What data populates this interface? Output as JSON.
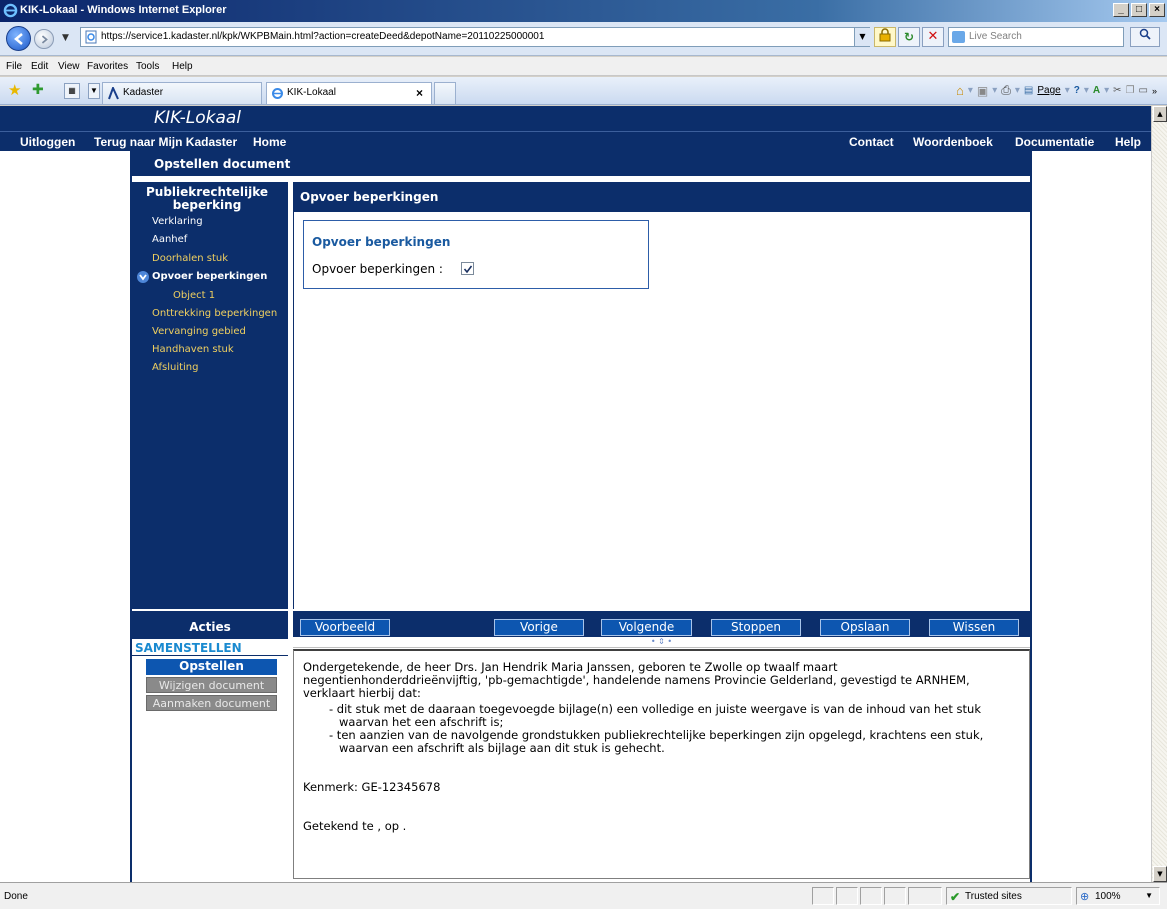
{
  "window": {
    "title": "KIK-Lokaal - Windows Internet Explorer",
    "buttons": [
      "_",
      "□",
      "×"
    ]
  },
  "address_bar": {
    "url": "https://service1.kadaster.nl/kpk/WKPBMain.html?action=createDeed&depotName=20110225000001",
    "search_placeholder": "Live Search"
  },
  "menu": {
    "items": [
      "File",
      "Edit",
      "View",
      "Favorites",
      "Tools",
      "Help"
    ]
  },
  "tabs": [
    {
      "label": "Kadaster"
    },
    {
      "label": "KIK-Lokaal",
      "active": true
    }
  ],
  "command_bar": {
    "page_label": "Page",
    "home_icon": "home-icon",
    "feeds_icon": "feeds-icon",
    "print_icon": "print-icon",
    "tools_icon": "tools-icon",
    "help_icon": "help-icon"
  },
  "app": {
    "title": "KIK-Lokaal",
    "nav_left": [
      "Uitloggen",
      "Terug naar Mijn Kadaster",
      "Home"
    ],
    "nav_right": [
      "Contact",
      "Woordenboek",
      "Documentatie",
      "Help"
    ],
    "document_header": "Opstellen document",
    "colors": {
      "primary": "#0c2e6b",
      "accent": "#0d56b0",
      "nav_link": "#f0d060"
    }
  },
  "sidebar": {
    "title_line1": "Publiekrechtelijke",
    "title_line2": "beperking",
    "items": [
      {
        "label": "Verklaring",
        "state": "visited"
      },
      {
        "label": "Aanhef",
        "state": "visited"
      },
      {
        "label": "Doorhalen stuk",
        "state": "normal"
      },
      {
        "label": "Opvoer beperkingen",
        "state": "active"
      },
      {
        "label": "Object 1",
        "state": "normal"
      },
      {
        "label": "Onttrekking beperkingen",
        "state": "normal"
      },
      {
        "label": "Vervanging gebied",
        "state": "normal"
      },
      {
        "label": "Handhaven stuk",
        "state": "normal"
      },
      {
        "label": "Afsluiting",
        "state": "normal"
      }
    ]
  },
  "content": {
    "heading": "Opvoer beperkingen",
    "fieldset_title": "Opvoer beperkingen",
    "field_label": "Opvoer beperkingen :",
    "field_checked": true
  },
  "actions": {
    "title": "Acties",
    "section": "SAMENSTELLEN",
    "buttons": [
      {
        "label": "Opstellen document",
        "enabled": true
      },
      {
        "label": "Wijzigen document",
        "enabled": false
      },
      {
        "label": "Aanmaken document",
        "enabled": false
      }
    ]
  },
  "button_bar": [
    "Voorbeeld",
    "Vorige",
    "Volgende",
    "Stoppen",
    "Opslaan",
    "Wissen"
  ],
  "preview": {
    "paragraph": "Ondergetekende, de heer Drs. Jan Hendrik Maria Janssen, geboren te Zwolle op twaalf maart negentienhonderddrieënvijftig, 'pb-gemachtigde', handelende namens Provincie Gelderland, gevestigd te ARNHEM, verklaart hierbij dat:",
    "bullets": [
      "- dit stuk met de daaraan toegevoegde bijlage(n) een volledige en juiste weergave is van de inhoud van het stuk waarvan het een afschrift is;",
      "- ten aanzien van de navolgende grondstukken publiekrechtelijke beperkingen zijn opgelegd, krachtens een stuk, waarvan een afschrift als bijlage aan dit stuk is gehecht."
    ],
    "kenmerk": "Kenmerk: GE-12345678",
    "getekend": "Getekend te , op ."
  },
  "status_bar": {
    "status": "Done",
    "zone": "Trusted sites",
    "zoom": "100%"
  }
}
